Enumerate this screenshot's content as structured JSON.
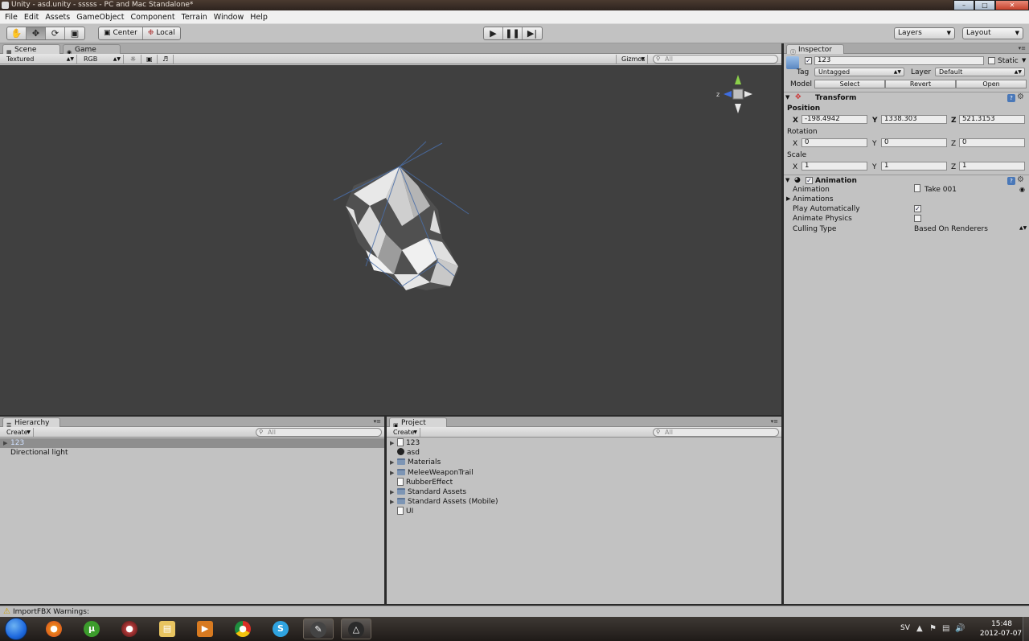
{
  "window": {
    "title": "Unity - asd.unity - sssss - PC and Mac Standalone*"
  },
  "menu": [
    "File",
    "Edit",
    "Assets",
    "GameObject",
    "Component",
    "Terrain",
    "Window",
    "Help"
  ],
  "toolbar": {
    "pivot_center": "Center",
    "pivot_local": "Local",
    "layers": "Layers",
    "layout": "Layout"
  },
  "scene": {
    "tab_scene": "Scene",
    "tab_game": "Game",
    "render_mode": "Textured",
    "color_mode": "RGB",
    "gizmos": "Gizmos",
    "search_placeholder": "All",
    "axis_label": "z"
  },
  "hierarchy": {
    "tab": "Hierarchy",
    "create": "Create",
    "search_placeholder": "All",
    "items": [
      {
        "label": "123",
        "selected": true,
        "foldable": true
      },
      {
        "label": "Directional light",
        "selected": false,
        "foldable": false
      }
    ]
  },
  "project": {
    "tab": "Project",
    "create": "Create",
    "search_placeholder": "All",
    "items": [
      {
        "label": "123",
        "icon": "prefab-icon",
        "foldable": true
      },
      {
        "label": "asd",
        "icon": "unity-scene-icon",
        "foldable": false
      },
      {
        "label": "Materials",
        "icon": "folder-icon",
        "foldable": true
      },
      {
        "label": "MeleeWeaponTrail",
        "icon": "folder-icon",
        "foldable": true
      },
      {
        "label": "RubberEffect",
        "icon": "script-icon",
        "foldable": false
      },
      {
        "label": "Standard Assets",
        "icon": "folder-icon",
        "foldable": true
      },
      {
        "label": "Standard Assets (Mobile)",
        "icon": "folder-icon",
        "foldable": true
      },
      {
        "label": "UI",
        "icon": "script-icon",
        "foldable": false
      }
    ]
  },
  "inspector": {
    "tab": "Inspector",
    "object_name": "123",
    "static_label": "Static",
    "tag_label": "Tag",
    "tag_value": "Untagged",
    "layer_label": "Layer",
    "layer_value": "Default",
    "model_label": "Model",
    "model_select": "Select",
    "model_revert": "Revert",
    "model_open": "Open",
    "transform": {
      "title": "Transform",
      "position_label": "Position",
      "rotation_label": "Rotation",
      "scale_label": "Scale",
      "position": {
        "x": "-198.4942",
        "y": "1338.303",
        "z": "521.3153"
      },
      "rotation": {
        "x": "0",
        "y": "0",
        "z": "0"
      },
      "scale": {
        "x": "1",
        "y": "1",
        "z": "1"
      }
    },
    "animation": {
      "title": "Animation",
      "animation_label": "Animation",
      "animation_value": "Take 001",
      "animations_label": "Animations",
      "play_auto_label": "Play Automatically",
      "play_auto_checked": true,
      "animate_physics_label": "Animate Physics",
      "animate_physics_checked": false,
      "culling_label": "Culling Type",
      "culling_value": "Based On Renderers"
    }
  },
  "status": {
    "message": "ImportFBX Warnings:"
  },
  "tray": {
    "language": "SV",
    "time": "15:48",
    "date": "2012-07-07"
  }
}
